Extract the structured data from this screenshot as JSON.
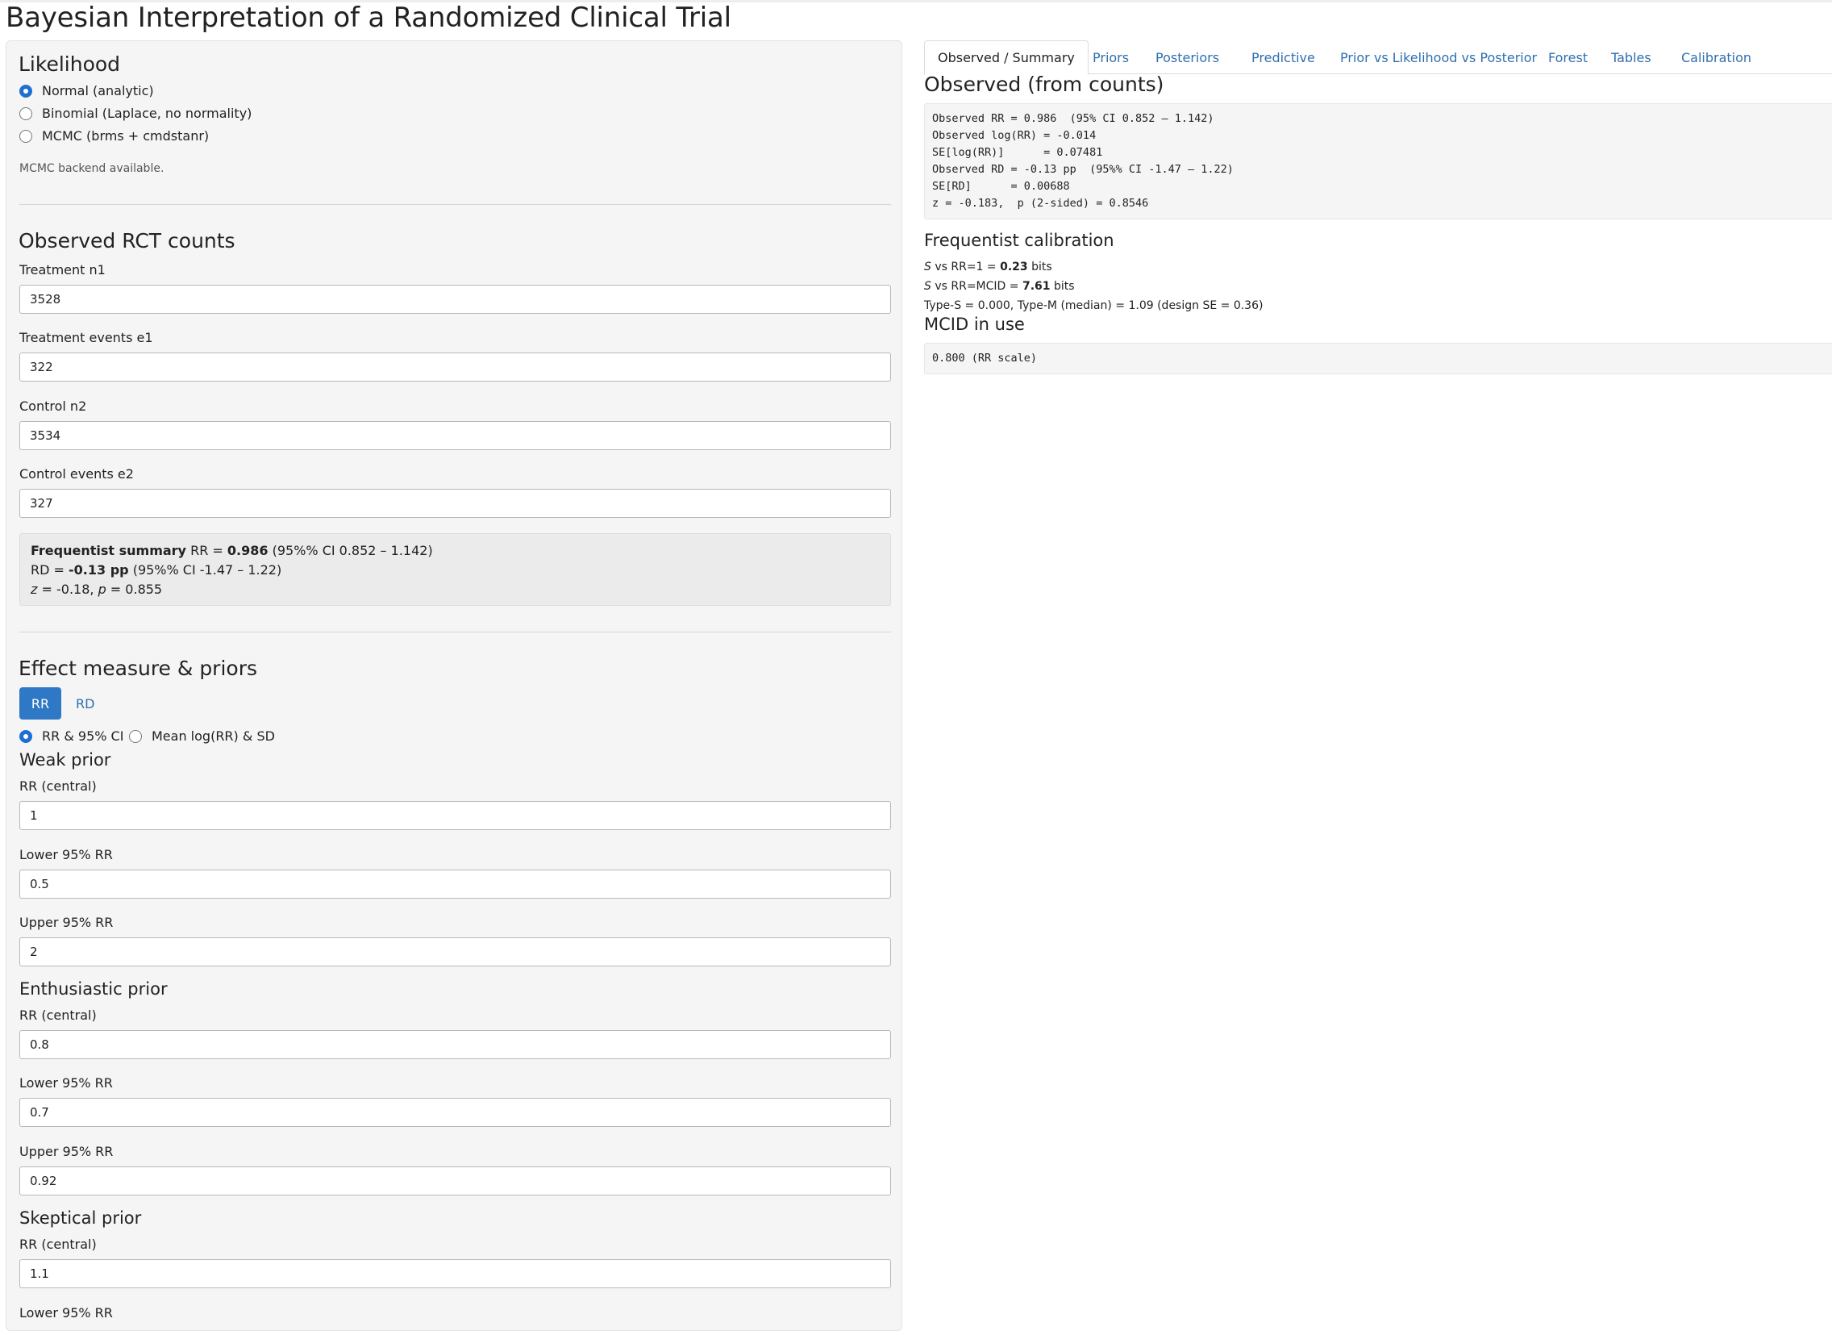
{
  "page": {
    "title": "Bayesian Interpretation of a Randomized Clinical Trial"
  },
  "sidebar": {
    "likelihood": {
      "heading": "Likelihood",
      "options": [
        "Normal (analytic)",
        "Binomial (Laplace, no normality)",
        "MCMC (brms + cmdstanr)"
      ],
      "selected_index": 0,
      "help_text": "MCMC backend available."
    },
    "counts": {
      "heading": "Observed RCT counts",
      "treatment_n1": {
        "label": "Treatment n1",
        "value": "3528"
      },
      "treatment_e1": {
        "label": "Treatment events e1",
        "value": "322"
      },
      "control_n2": {
        "label": "Control n2",
        "value": "3534"
      },
      "control_e2": {
        "label": "Control events e2",
        "value": "327"
      }
    },
    "freq_summary": {
      "title": "Frequentist summary",
      "rr_prefix": "RR = ",
      "rr_value": "0.986",
      "rr_ci": "(95%% CI 0.852 – 1.142)",
      "rd_prefix": "RD = ",
      "rd_value": "-0.13 pp",
      "rd_ci": "(95%% CI -1.47 – 1.22)",
      "z_var": "z",
      "z_value": " = -0.18, ",
      "p_var": "p",
      "p_value": " = 0.855"
    },
    "priors": {
      "heading": "Effect measure & priors",
      "measure_tabs": [
        "RR",
        "RD"
      ],
      "active_measure": "RR",
      "spec_options": [
        "RR & 95% CI",
        "Mean log(RR) & SD"
      ],
      "spec_selected_index": 0,
      "weak": {
        "heading": "Weak prior",
        "central": {
          "label": "RR (central)",
          "value": "1"
        },
        "lower": {
          "label": "Lower 95% RR",
          "value": "0.5"
        },
        "upper": {
          "label": "Upper 95% RR",
          "value": "2"
        }
      },
      "enthusiastic": {
        "heading": "Enthusiastic prior",
        "central": {
          "label": "RR (central)",
          "value": "0.8"
        },
        "lower": {
          "label": "Lower 95% RR",
          "value": "0.7"
        },
        "upper": {
          "label": "Upper 95% RR",
          "value": "0.92"
        }
      },
      "skeptical": {
        "heading": "Skeptical prior",
        "central": {
          "label": "RR (central)",
          "value": "1.1"
        },
        "lower_label_partial": "Lower 95% RR"
      }
    }
  },
  "main": {
    "tabs": [
      "Observed / Summary",
      "Priors",
      "Posteriors",
      "Predictive",
      "Prior vs Likelihood vs Posterior",
      "Forest",
      "Tables",
      "Calibration"
    ],
    "active_tab": "Observed / Summary",
    "observed": {
      "heading": "Observed (from counts)",
      "lines": [
        "Observed RR = 0.986  (95% CI 0.852 – 1.142)",
        "Observed log(RR) = -0.014",
        "SE[log(RR)]      = 0.07481",
        "Observed RD = -0.13 pp  (95%% CI -1.47 – 1.22)",
        "SE[RD]      = 0.00688",
        "z = -0.183,  p (2-sided) = 0.8546"
      ]
    },
    "calibration": {
      "heading": "Frequentist calibration",
      "s_symbol": "S",
      "s_null_text": " vs RR=1 = ",
      "s_null_value": "0.23",
      "s_mcid_text": " vs RR=MCID = ",
      "s_mcid_value": "7.61",
      "bits": " bits",
      "type_line": "Type-S = 0.000, Type-M (median) = 1.09 (design SE = 0.36)"
    },
    "mcid": {
      "heading": "MCID in use",
      "value": "0.800 (RR scale)"
    }
  }
}
